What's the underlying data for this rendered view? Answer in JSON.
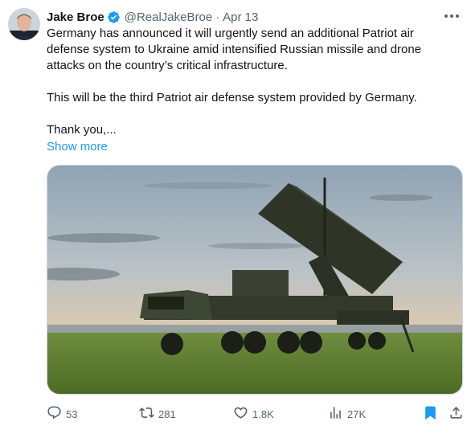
{
  "tweet": {
    "author_name": "Jake Broe",
    "handle": "@RealJakeBroe",
    "separator": "·",
    "date": "Apr 13",
    "verified": true,
    "text": {
      "line1": "Germany has announced it will urgently send an additional Patriot air",
      "line2": "defense system to Ukraine amid intensified Russian missile and drone",
      "line3": "attacks on the country’s critical infrastructure.",
      "line4": "This will be the third Patriot air defense system provided by Germany.",
      "line5": "Thank you,..."
    },
    "show_more": "Show more",
    "media": {
      "subject": "Patriot air defense launcher on military truck"
    }
  },
  "actions": {
    "replies": "53",
    "reposts": "281",
    "likes": "1.8K",
    "views": "27K"
  },
  "icons": {
    "verified": "verified-badge-icon",
    "more": "more-horizontal-icon",
    "reply": "reply-icon",
    "repost": "repost-icon",
    "like": "heart-icon",
    "views": "views-chart-icon",
    "bookmark": "bookmark-icon",
    "share": "share-icon"
  },
  "colors": {
    "accent": "#1d9bf0",
    "text": "#0f1419",
    "muted": "#536471"
  }
}
